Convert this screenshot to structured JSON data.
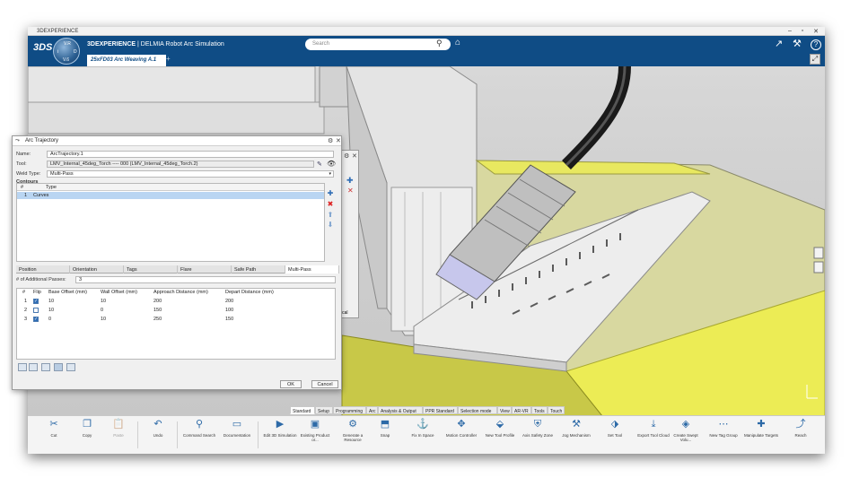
{
  "window": {
    "app_title": "3DEXPERIENCE",
    "minimize": "–",
    "maximize": "▫",
    "close": "✕"
  },
  "header": {
    "logo": "3DS",
    "compass": {
      "n": "V.R",
      "w": "i",
      "e": "D",
      "s": "V.6"
    },
    "brand_prefix": "3DEXPERIENCE",
    "brand_suffix": " | DELMIA Robot Arc Simulation",
    "search_placeholder": "Search",
    "search_icon": "⚲",
    "tag_icon": "⌂",
    "share_icon": "↗",
    "tools_icon": "⚒",
    "help_icon": "?",
    "tab_label": "25xFD03 Arc Weaving A.1",
    "tab_add": "+"
  },
  "dialog": {
    "title": "Arc Trajectory",
    "name_label": "Name:",
    "name_value": "ArcTrajectory.1",
    "tool_label": "Tool:",
    "tool_value": "LMV_Internal_45deg_Torch ---- 000 (LMV_Internal_45deg_Torch.2)",
    "weld_type_label": "Weld Type:",
    "weld_type_value": "Multi-Pass",
    "contours_label": "Contours",
    "contours_cols": [
      "#",
      "Type"
    ],
    "contours_rows": [
      {
        "num": "1",
        "type": "Curves"
      }
    ],
    "property_tabs": [
      "Position",
      "Orientation",
      "Tags",
      "Flare",
      "Safe Path",
      "Multi-Pass"
    ],
    "active_tab": "Multi-Pass",
    "additional_passes_label": "# of Additional Passes:",
    "additional_passes_value": "3",
    "passes_columns": [
      "#",
      "Flip",
      "Base Offset (mm)",
      "Wall Offset (mm)",
      "Approach Distance (mm)",
      "Depart Distance (mm)"
    ],
    "passes_rows": [
      {
        "num": "1",
        "flip": true,
        "base": "10",
        "wall": "10",
        "approach": "200",
        "depart": "200"
      },
      {
        "num": "2",
        "flip": false,
        "base": "10",
        "wall": "0",
        "approach": "150",
        "depart": "100"
      },
      {
        "num": "3",
        "flip": true,
        "base": "0",
        "wall": "10",
        "approach": "250",
        "depart": "150"
      }
    ],
    "ok_label": "OK",
    "cancel_label": "Cancel"
  },
  "panel2": {
    "ok_fragment": "ical"
  },
  "toolbar_tabs": [
    "Standard",
    "Setup",
    "Programming",
    "Arc",
    "Analysis & Output",
    "PPR Standard",
    "Selection mode",
    "View",
    "AR-VR",
    "Tools",
    "Touch"
  ],
  "active_toolbar_tab": "Standard",
  "actions": [
    {
      "label": "Cut",
      "icon": "✂"
    },
    {
      "label": "Copy",
      "icon": "❐"
    },
    {
      "label": "Paste",
      "icon": "📋"
    },
    {
      "label": "Undo",
      "icon": "↶"
    },
    {
      "label": "Command Search",
      "icon": "⚲"
    },
    {
      "label": "Documentation",
      "icon": "▭"
    },
    {
      "label": "Edit 3D Simulation",
      "icon": "▶"
    },
    {
      "label": "Existing Product or...",
      "icon": "▣"
    },
    {
      "label": "Generate a Resource",
      "icon": "⚙"
    },
    {
      "label": "Snap",
      "icon": "⬒"
    },
    {
      "label": "Fix In Space",
      "icon": "⚓"
    },
    {
      "label": "Motion Controller",
      "icon": "✥"
    },
    {
      "label": "New Tool Profile",
      "icon": "⬙"
    },
    {
      "label": "Axis Safety Zone",
      "icon": "⛨"
    },
    {
      "label": "Jog Mechanism",
      "icon": "⚒"
    },
    {
      "label": "Set Tool",
      "icon": "⬗"
    },
    {
      "label": "Export Tool Cloud",
      "icon": "⤓"
    },
    {
      "label": "Create Swept Volu...",
      "icon": "◈"
    },
    {
      "label": "New Tag Group",
      "icon": "⋯"
    },
    {
      "label": "Manipulate Targets",
      "icon": "✚"
    },
    {
      "label": "Reach",
      "icon": "⤴"
    }
  ]
}
